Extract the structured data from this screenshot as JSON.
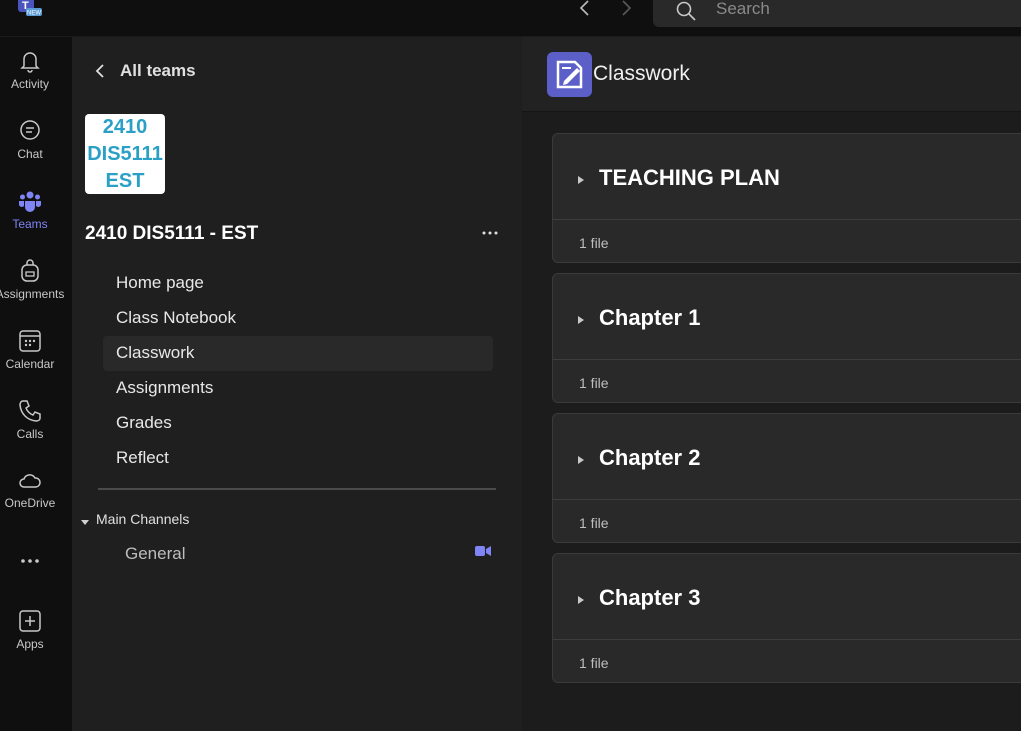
{
  "topbar": {
    "search_placeholder": "Search",
    "logo_badge": "NEW"
  },
  "rail": {
    "items": [
      {
        "label": "Activity",
        "icon": "bell-icon"
      },
      {
        "label": "Chat",
        "icon": "chat-icon"
      },
      {
        "label": "Teams",
        "icon": "teams-icon",
        "active": true
      },
      {
        "label": "Assignments",
        "icon": "backpack-icon"
      },
      {
        "label": "Calendar",
        "icon": "calendar-icon"
      },
      {
        "label": "Calls",
        "icon": "phone-icon"
      },
      {
        "label": "OneDrive",
        "icon": "cloud-icon"
      },
      {
        "label": "",
        "icon": "more-icon"
      },
      {
        "label": "Apps",
        "icon": "add-app-icon"
      }
    ],
    "active_color": "#7f85f5"
  },
  "pane": {
    "back_label": "All teams",
    "team_tile_lines": [
      "2410",
      "DIS5111",
      "EST"
    ],
    "team_name": "2410 DIS5111 - EST",
    "nav": [
      "Home page",
      "Class Notebook",
      "Classwork",
      "Assignments",
      "Grades",
      "Reflect"
    ],
    "selected_nav": "Classwork",
    "section_label": "Main Channels",
    "channel": "General"
  },
  "main": {
    "title": "Classwork",
    "accent": "#5b5fc7",
    "cards": [
      {
        "title": "TEACHING PLAN",
        "count": "1 file"
      },
      {
        "title": "Chapter 1",
        "count": "1 file"
      },
      {
        "title": "Chapter 2",
        "count": "1 file"
      },
      {
        "title": "Chapter 3",
        "count": "1 file"
      }
    ]
  }
}
